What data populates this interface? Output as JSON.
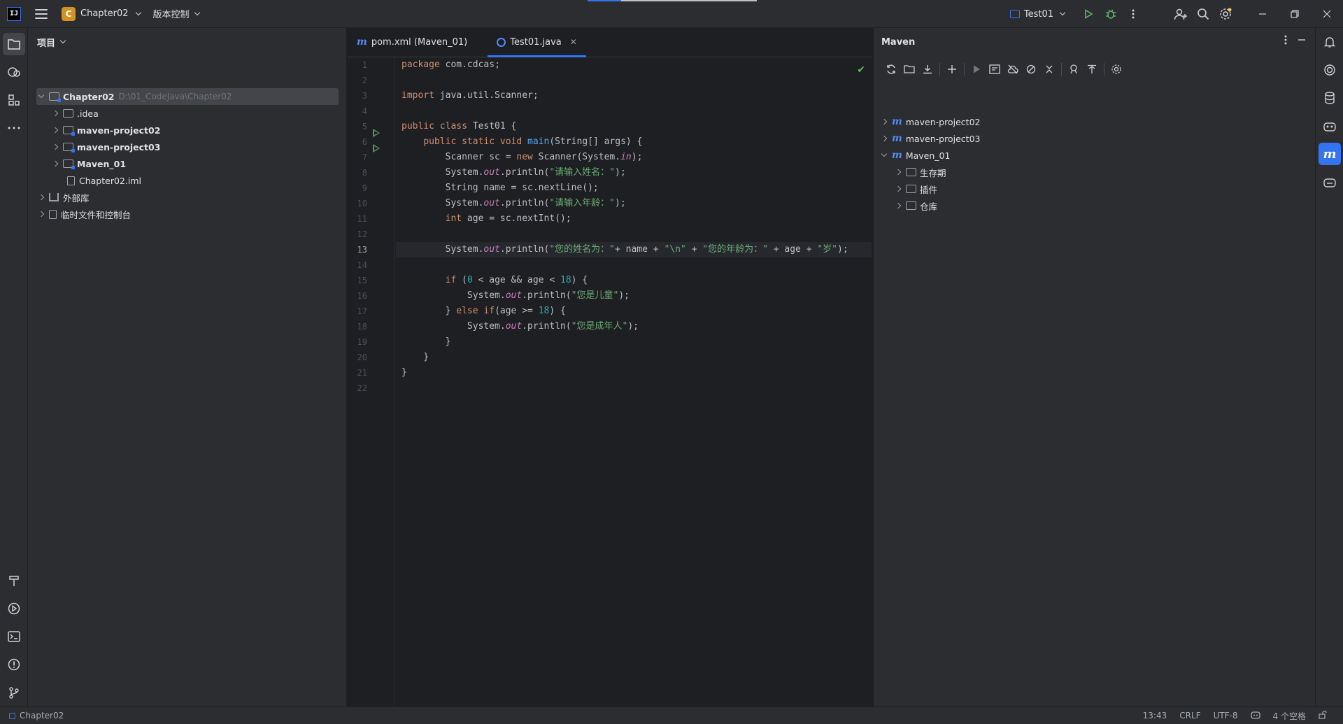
{
  "titlebar": {
    "app_logo": "IJ",
    "project_badge": "C",
    "project_name": "Chapter02",
    "vcs_label": "版本控制",
    "run_config": "Test01"
  },
  "project_panel": {
    "title": "项目",
    "tree": [
      {
        "label": "Chapter02",
        "hint": "D:\\01_CodeJava\\Chapter02"
      },
      {
        "label": ".idea"
      },
      {
        "label": "maven-project02"
      },
      {
        "label": "maven-project03"
      },
      {
        "label": "Maven_01"
      },
      {
        "label": "Chapter02.iml"
      },
      {
        "label": "外部库"
      },
      {
        "label": "临时文件和控制台"
      }
    ]
  },
  "editor": {
    "tabs": [
      {
        "label": "pom.xml (Maven_01)"
      },
      {
        "label": "Test01.java"
      }
    ],
    "current_line": 13,
    "line_numbers": [
      "1",
      "2",
      "3",
      "4",
      "5",
      "6",
      "7",
      "8",
      "9",
      "10",
      "11",
      "12",
      "13",
      "14",
      "15",
      "16",
      "17",
      "18",
      "19",
      "20",
      "21",
      "22"
    ]
  },
  "maven": {
    "title": "Maven",
    "tree": [
      {
        "label": "maven-project02"
      },
      {
        "label": "maven-project03"
      },
      {
        "label": "Maven_01"
      },
      {
        "label": "生存期"
      },
      {
        "label": "插件"
      },
      {
        "label": "仓库"
      }
    ]
  },
  "statusbar": {
    "project": "Chapter02",
    "position": "13:43",
    "line_sep": "CRLF",
    "encoding": "UTF-8",
    "indent": "4 个空格"
  },
  "colors": {
    "accent": "#3574f0",
    "keyword": "#cf8e6d",
    "string": "#6aab73",
    "function": "#56a8f5",
    "number": "#2aacb8",
    "static_field": "#c77dbb"
  },
  "icons": [
    "hamburger-icon",
    "run-icon",
    "debug-icon",
    "more-icon",
    "add-user-icon",
    "search-icon",
    "settings-icon",
    "minimize-icon",
    "restore-icon",
    "close-icon",
    "folder-icon",
    "refresh-icon",
    "download-icon",
    "plus-icon",
    "bell-icon",
    "database-icon",
    "maven-icon"
  ]
}
